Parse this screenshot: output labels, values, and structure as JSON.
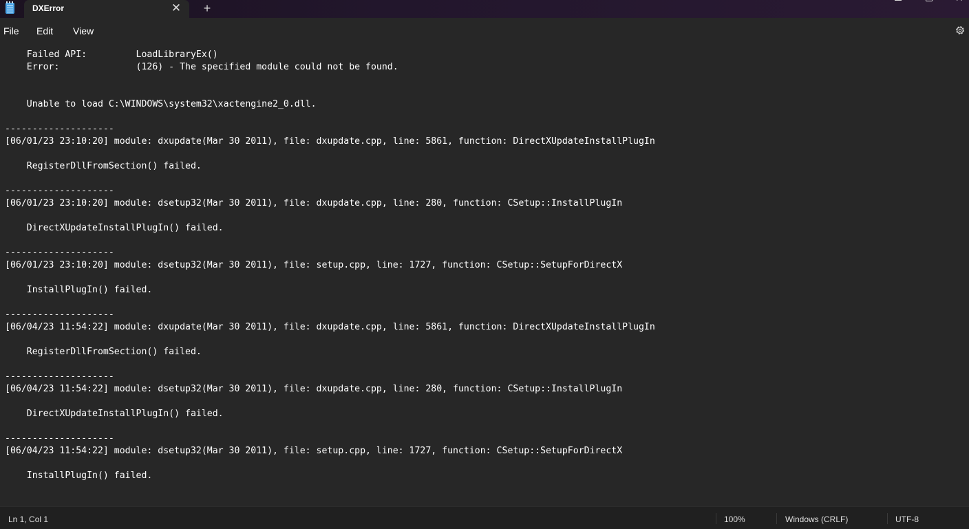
{
  "window": {
    "tab_title": "DXError",
    "close_tab_glyph": "✕",
    "new_tab_glyph": "+"
  },
  "menu": {
    "file": "File",
    "edit": "Edit",
    "view": "View"
  },
  "editor": {
    "lines": [
      "    Failed API:         LoadLibraryEx()",
      "    Error:              (126) - The specified module could not be found.",
      "",
      "",
      "    Unable to load C:\\WINDOWS\\system32\\xactengine2_0.dll.",
      "",
      "--------------------",
      "[06/01/23 23:10:20] module: dxupdate(Mar 30 2011), file: dxupdate.cpp, line: 5861, function: DirectXUpdateInstallPlugIn",
      "",
      "    RegisterDllFromSection() failed.",
      "",
      "--------------------",
      "[06/01/23 23:10:20] module: dsetup32(Mar 30 2011), file: dxupdate.cpp, line: 280, function: CSetup::InstallPlugIn",
      "",
      "    DirectXUpdateInstallPlugIn() failed.",
      "",
      "--------------------",
      "[06/01/23 23:10:20] module: dsetup32(Mar 30 2011), file: setup.cpp, line: 1727, function: CSetup::SetupForDirectX",
      "",
      "    InstallPlugIn() failed.",
      "",
      "--------------------",
      "[06/04/23 11:54:22] module: dxupdate(Mar 30 2011), file: dxupdate.cpp, line: 5861, function: DirectXUpdateInstallPlugIn",
      "",
      "    RegisterDllFromSection() failed.",
      "",
      "--------------------",
      "[06/04/23 11:54:22] module: dsetup32(Mar 30 2011), file: dxupdate.cpp, line: 280, function: CSetup::InstallPlugIn",
      "",
      "    DirectXUpdateInstallPlugIn() failed.",
      "",
      "--------------------",
      "[06/04/23 11:54:22] module: dsetup32(Mar 30 2011), file: setup.cpp, line: 1727, function: CSetup::SetupForDirectX",
      "",
      "    InstallPlugIn() failed."
    ]
  },
  "status": {
    "position": "Ln 1, Col 1",
    "zoom": "100%",
    "line_ending": "Windows (CRLF)",
    "encoding": "UTF-8"
  },
  "icons": {
    "app": "notepad-icon",
    "settings": "gear-icon"
  }
}
